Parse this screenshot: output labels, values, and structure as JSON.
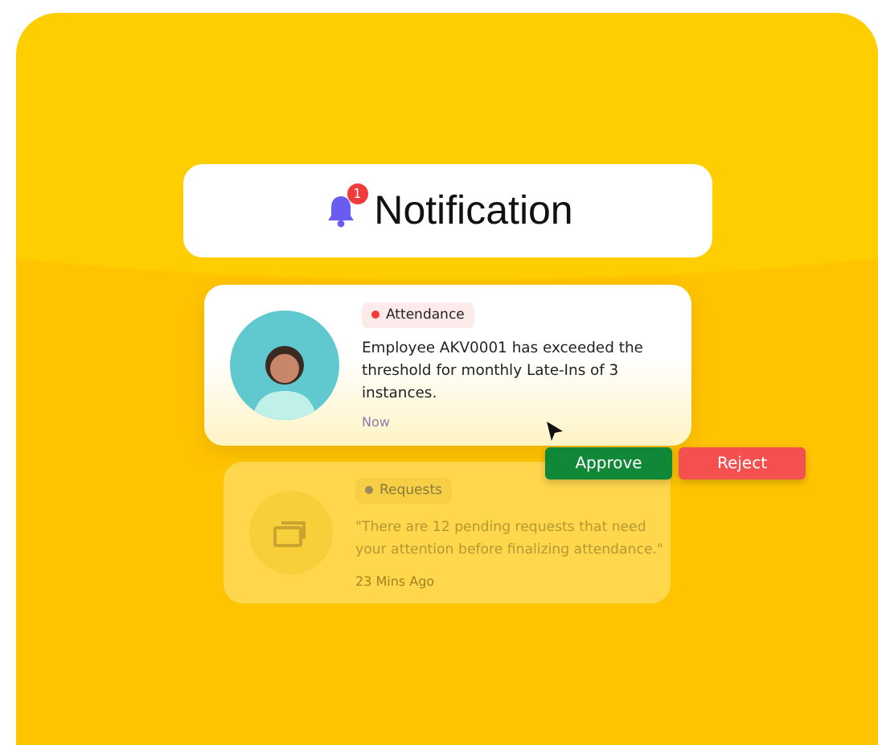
{
  "header": {
    "title": "Notification",
    "badge": "1"
  },
  "notifications": [
    {
      "kind": "avatar",
      "dimmed": false,
      "tag": "Attendance",
      "color": "#ef3b3b",
      "message": "Employee AKV0001 has exceeded the threshold for monthly Late-Ins of 3 instances.",
      "time": "Now"
    },
    {
      "kind": "icon",
      "dimmed": true,
      "tag": "Requests",
      "color": "#9a8a5a",
      "message": "\"There are 12 pending requests that need your attention before finalizing attendance.\"",
      "time": "23 Mins Ago"
    }
  ],
  "actions": [
    {
      "label": "Approve",
      "kind": "approve"
    },
    {
      "label": "Reject",
      "kind": "reject"
    }
  ]
}
